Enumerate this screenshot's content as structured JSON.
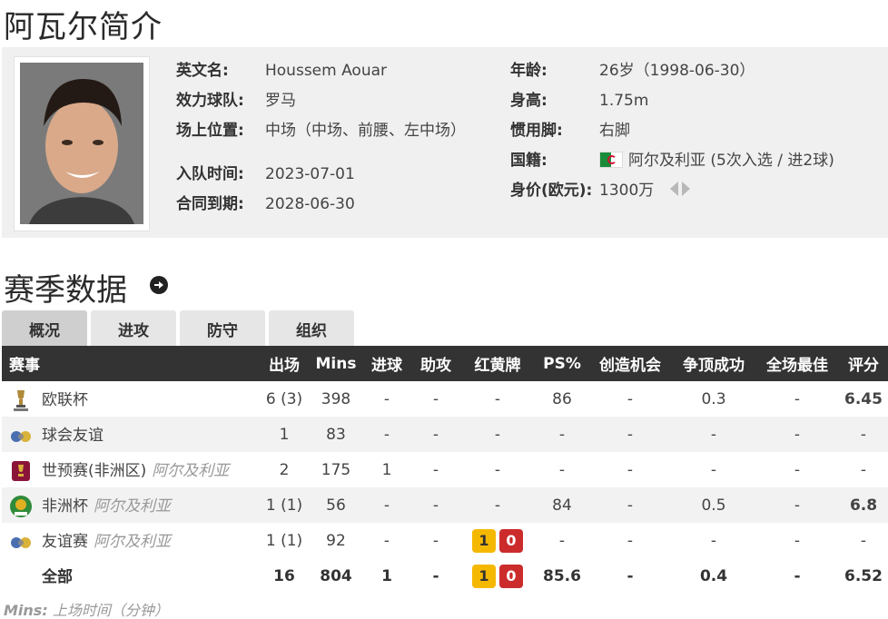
{
  "page": {
    "title": "阿瓦尔简介"
  },
  "profile": {
    "left": [
      {
        "label": "英文名:",
        "value": "Houssem Aouar"
      },
      {
        "label": "效力球队:",
        "value": "罗马"
      },
      {
        "label": "场上位置:",
        "value": "中场（中场、前腰、左中场）"
      },
      {
        "label": "入队时间:",
        "value": "2023-07-01"
      },
      {
        "label": "合同到期:",
        "value": "2028-06-30"
      }
    ],
    "right": [
      {
        "label": "年龄:",
        "value": "26岁（1998-06-30）"
      },
      {
        "label": "身高:",
        "value": "1.75m"
      },
      {
        "label": "惯用脚:",
        "value": "右脚"
      },
      {
        "label": "国籍:",
        "value": "阿尔及利亚 (5次入选 / 进2球)",
        "icon": "algeria-flag-icon"
      },
      {
        "label": "身价(欧元):",
        "value": "1300万",
        "icon": "value-trend-arrows-icon"
      }
    ]
  },
  "season": {
    "title": "赛季数据",
    "tabs": [
      {
        "label": "概况",
        "active": true
      },
      {
        "label": "进攻",
        "active": false
      },
      {
        "label": "防守",
        "active": false
      },
      {
        "label": "组织",
        "active": false
      }
    ],
    "columns": [
      "赛事",
      "出场",
      "Mins",
      "进球",
      "助攻",
      "红黄牌",
      "PS%",
      "创造机会",
      "争顶成功",
      "全场最佳",
      "评分"
    ],
    "rows": [
      {
        "icon": "europa-league-icon",
        "name": "欧联杯",
        "sub": "",
        "apps": "6 (3)",
        "mins": "398",
        "goals": "-",
        "assists": "-",
        "cards": "-",
        "ps": "86",
        "chances": "-",
        "aerial": "0.3",
        "motm": "-",
        "rating": "6.45"
      },
      {
        "icon": "club-friendly-icon",
        "name": "球会友谊",
        "sub": "",
        "apps": "1",
        "mins": "83",
        "goals": "-",
        "assists": "-",
        "cards": "-",
        "ps": "-",
        "chances": "-",
        "aerial": "-",
        "motm": "-",
        "rating": "-"
      },
      {
        "icon": "world-cup-qualifier-icon",
        "name": "世预赛(非洲区)",
        "sub": "阿尔及利亚",
        "apps": "2",
        "mins": "175",
        "goals": "1",
        "assists": "-",
        "cards": "-",
        "ps": "-",
        "chances": "-",
        "aerial": "-",
        "motm": "-",
        "rating": "-"
      },
      {
        "icon": "caf-icon",
        "name": "非洲杯",
        "sub": "阿尔及利亚",
        "apps": "1 (1)",
        "mins": "56",
        "goals": "-",
        "assists": "-",
        "cards": "-",
        "ps": "84",
        "chances": "-",
        "aerial": "0.5",
        "motm": "-",
        "rating": "6.8"
      },
      {
        "icon": "friendly-icon",
        "name": "友谊赛",
        "sub": "阿尔及利亚",
        "apps": "1 (1)",
        "mins": "92",
        "goals": "-",
        "assists": "-",
        "yellow": "1",
        "red": "0",
        "ps": "-",
        "chances": "-",
        "aerial": "-",
        "motm": "-",
        "rating": "-"
      }
    ],
    "total": {
      "name": "全部",
      "apps": "16",
      "mins": "804",
      "goals": "1",
      "assists": "-",
      "yellow": "1",
      "red": "0",
      "ps": "85.6",
      "chances": "-",
      "aerial": "0.4",
      "motm": "-",
      "rating": "6.52"
    },
    "footnote": {
      "key": "Mins:",
      "text": "上场时间（分钟）"
    }
  },
  "colors": {
    "header_bg": "#333333",
    "rating": "#e05a00",
    "yellow_card": "#f5b800",
    "red_card": "#cc2b2b"
  }
}
